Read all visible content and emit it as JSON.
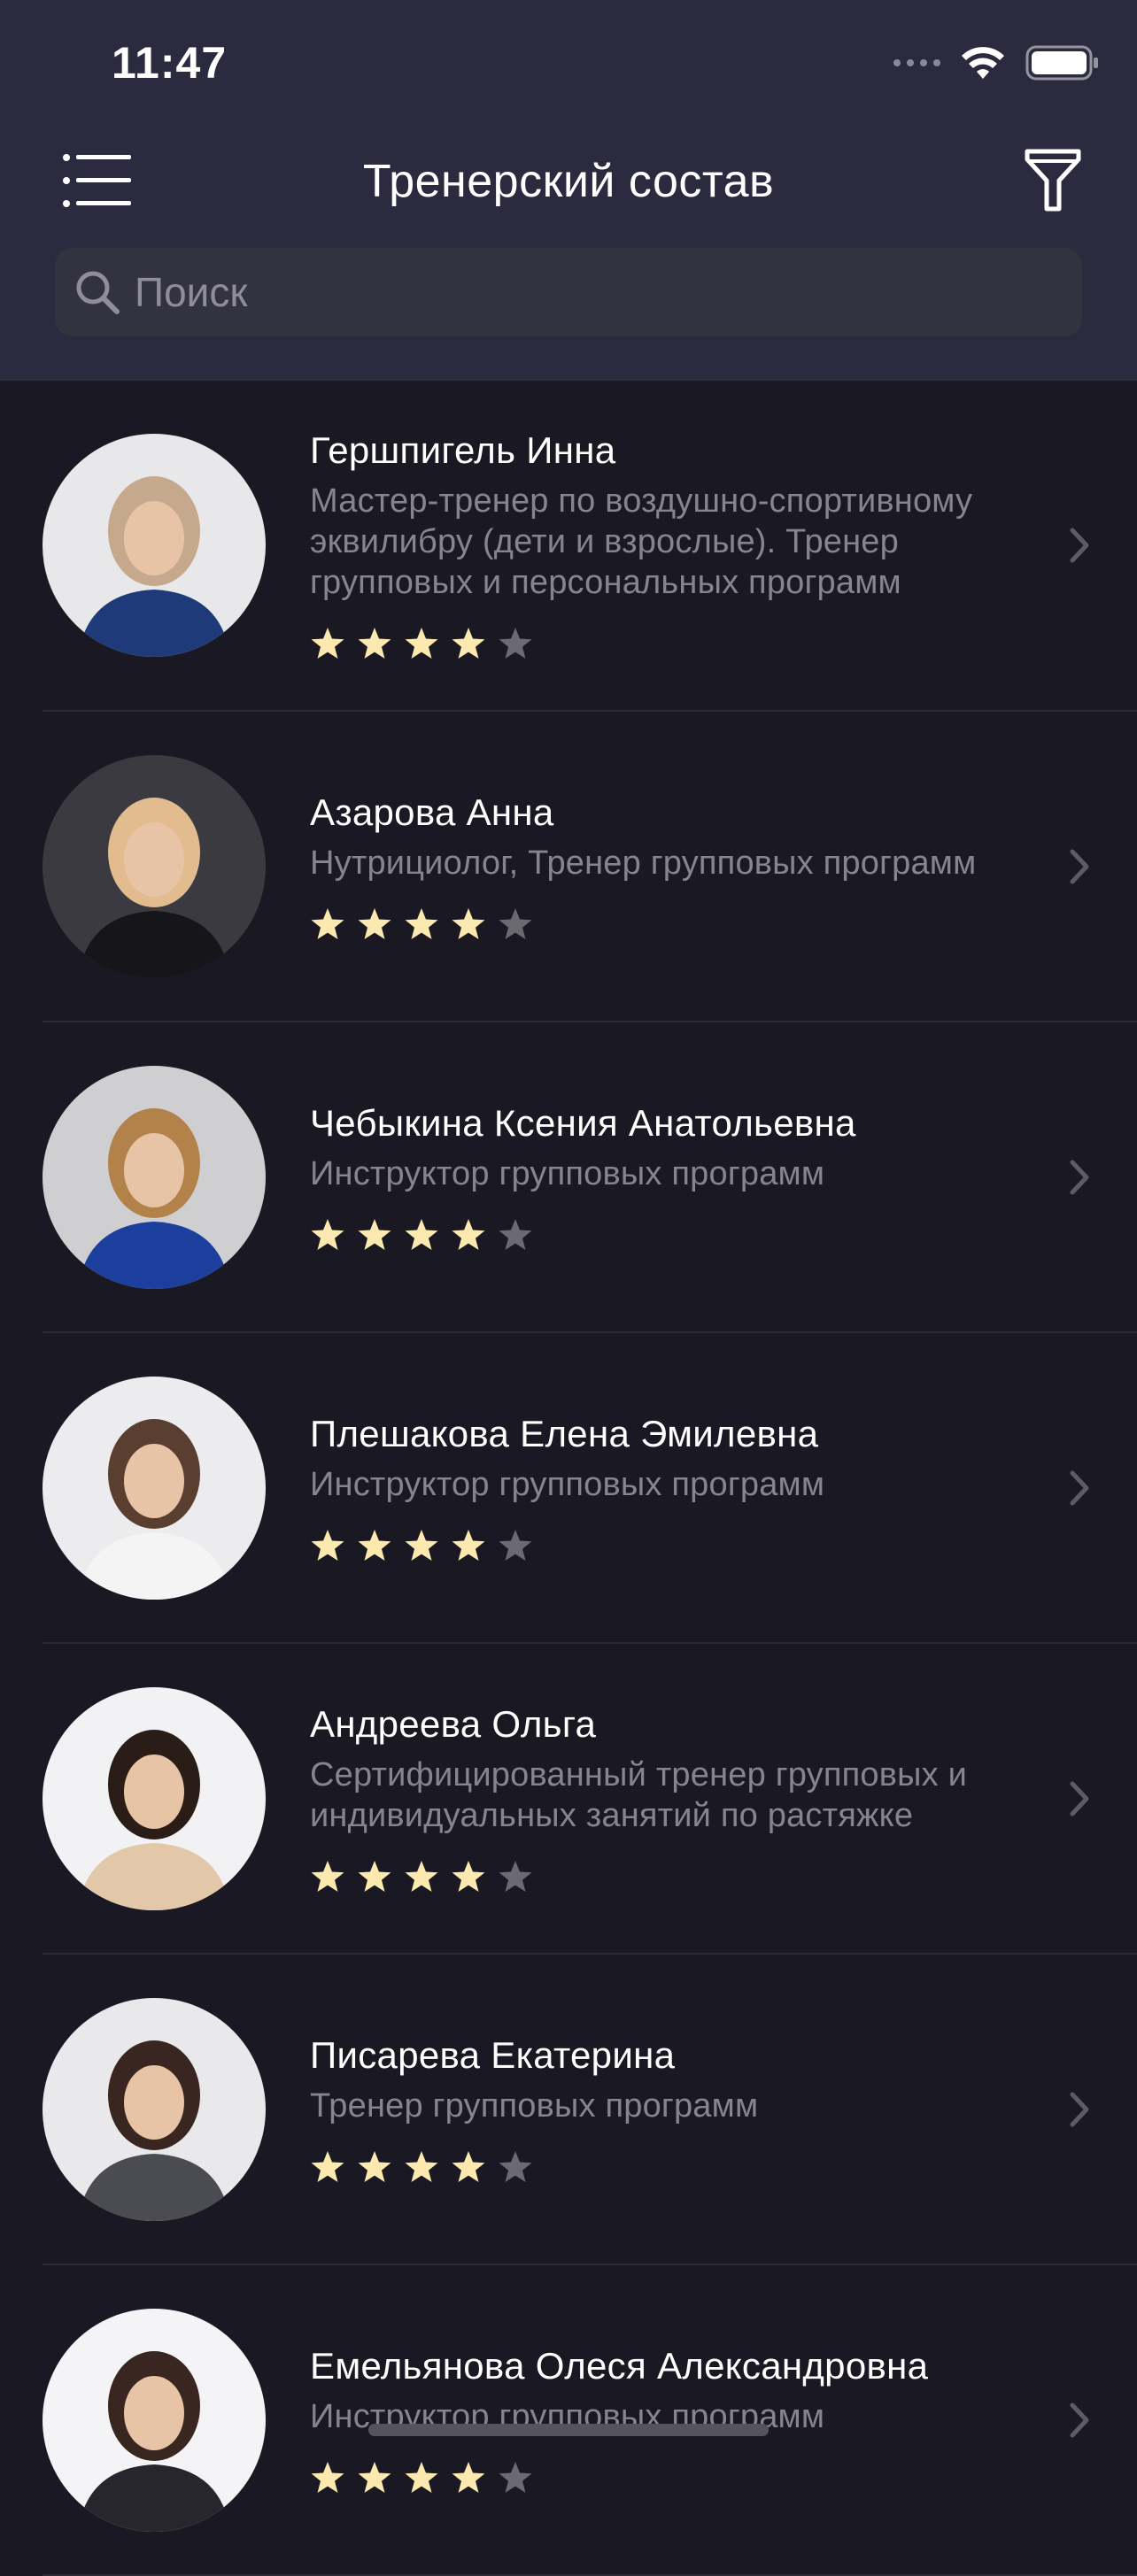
{
  "status": {
    "time": "11:47"
  },
  "header": {
    "title": "Тренерский состав",
    "search_placeholder": "Поиск"
  },
  "colors": {
    "background": "#1a1822",
    "header": "#2b2a3f",
    "star_filled": "#fbe9b0",
    "star_empty": "#6b6a73"
  },
  "trainers": [
    {
      "name": "Гершпигель Инна",
      "desc": "Мастер-тренер по воздушно-спортивному эквилибру (дети и взрослые). Тренер групповых и персональных программ",
      "rating": 4
    },
    {
      "name": "Азарова Анна",
      "desc": "Нутрициолог, Тренер групповых программ",
      "rating": 4
    },
    {
      "name": "Чебыкина Ксения Анатольевна",
      "desc": "Инструктор групповых программ",
      "rating": 4
    },
    {
      "name": "Плешакова Елена Эмилевна",
      "desc": "Инструктор групповых программ",
      "rating": 4
    },
    {
      "name": "Андреева Ольга",
      "desc": "Сертифицированный тренер групповых и индивидуальных занятий по растяжке",
      "rating": 4
    },
    {
      "name": "Писарева Екатерина",
      "desc": "Тренер групповых программ",
      "rating": 4
    },
    {
      "name": "Емельянова Олеся Александровна",
      "desc": "Инструктор групповых программ",
      "rating": 4
    }
  ]
}
